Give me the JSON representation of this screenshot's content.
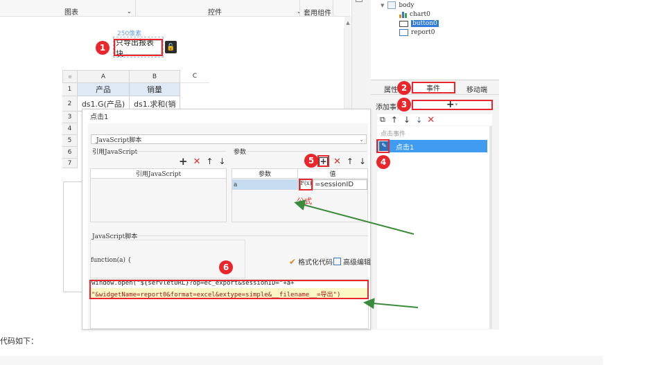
{
  "toolbar": {
    "chart_label": "图表",
    "control_label": "控件",
    "template_label": "套用组件"
  },
  "tree": {
    "items": [
      "body",
      "chart0",
      "button0",
      "report0"
    ]
  },
  "canvas": {
    "size_hint": "250像素",
    "button_text": "只导出报表块",
    "col_headers": [
      "A",
      "B",
      "C"
    ],
    "row_numbers": [
      "1",
      "2",
      "3",
      "4",
      "5",
      "6",
      "7"
    ],
    "cell_a1": "产品",
    "cell_b1": "销量",
    "cell_a2": "ds1.G(产品)",
    "cell_b2": "ds1.求和(销"
  },
  "panel": {
    "tab_attr": "属性",
    "tab_event": "事件",
    "tab_mobile": "移动端",
    "add_event_label": "添加事件",
    "category": "点击事件",
    "selected_event": "点击1"
  },
  "dialog": {
    "title": "点击1",
    "type_select": "JavaScript脚本",
    "ref_js_section": "引用JavaScript",
    "params_section": "参数",
    "ref_js_header": "引用JavaScript",
    "param_header": "参数",
    "value_header": "值",
    "param_name": "a",
    "fx_label": "F(x)",
    "param_value": "=sessionID",
    "formula_note": "公式",
    "script_section": "JavaScript脚本",
    "function_sig": "function(a) {",
    "format_code": "格式化代码",
    "advanced_edit": "高级编辑",
    "code_line1": "window.open(\"${servletURL}?op=ec_export&sessionID=\"+a+",
    "code_line2": "\"&widgetName=report0&format=excel&extype=simple&__filename__=导出\")"
  },
  "badges": [
    "1",
    "2",
    "3",
    "4",
    "5",
    "6"
  ],
  "footer": {
    "text": "代码如下："
  },
  "colors": {
    "accent_red": "#e8262b",
    "selection_blue": "#3f9cf0",
    "arrow_green": "#3c8a3c",
    "code_highlight": "#fbf8c6"
  }
}
